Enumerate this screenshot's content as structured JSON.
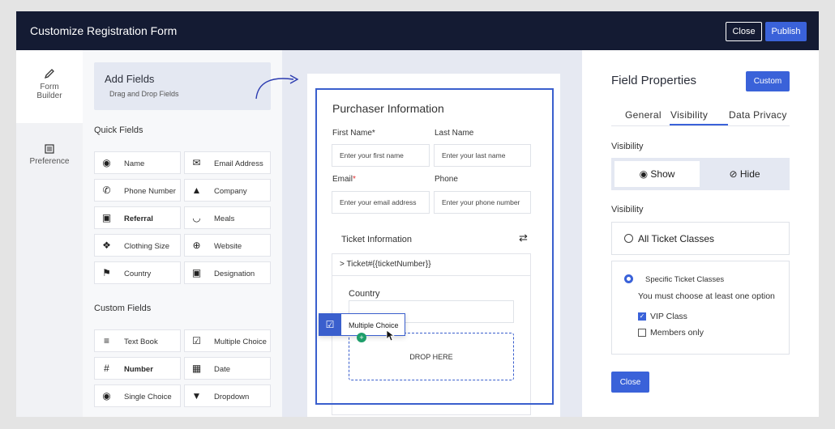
{
  "header": {
    "title": "Customize Registration Form",
    "close_label": "Close",
    "publish_label": "Publish"
  },
  "nav": {
    "form_builder_line1": "Form",
    "form_builder_line2": "Builder",
    "preference": "Preference"
  },
  "fields": {
    "add_title": "Add Fields",
    "add_subtitle": "Drag and Drop Fields",
    "quick_label": "Quick Fields",
    "quick": [
      "Name",
      "Email Address",
      "Phone Number",
      "Company",
      "Referral",
      "Meals",
      "Clothing Size",
      "Website",
      "Country",
      "Designation"
    ],
    "custom_label": "Custom Fields",
    "custom": [
      "Text Book",
      "Multiple Choice",
      "Number",
      "Date",
      "Single Choice",
      "Dropdown"
    ]
  },
  "form": {
    "purchaser_title": "Purchaser Information",
    "first_name_label": "First Name*",
    "last_name_label": "Last Name",
    "first_name_placeholder": "Enter your first name",
    "last_name_placeholder": "Enter your last name",
    "email_label": "Email",
    "email_req": "*",
    "phone_label": "Phone",
    "email_placeholder": "Enter your email address",
    "phone_placeholder": "Enter your phone number",
    "ticket_title": "Ticket Information",
    "ticket_row": "> Ticket#{{ticketNumber}}",
    "country_label": "Country",
    "drop_here": "DROP HERE",
    "dragging": "Multiple Choice",
    "plus": "+"
  },
  "props": {
    "title": "Field Properties",
    "custom_label": "Custom",
    "tabs": [
      "General",
      "Visibility",
      "Data Privacy"
    ],
    "visibility_label": "Visibility",
    "show_label": "Show",
    "hide_label": "Hide",
    "visibility_label2": "Visibility",
    "all_classes": "All Ticket Classes",
    "specific_classes": "Specific Ticket Classes",
    "must_choose": "You must choose at least one option",
    "vip": "VIP Class",
    "members": "Members only",
    "close_label": "Close"
  },
  "colors": {
    "header_bg": "#141b33",
    "accent": "#3a62d9",
    "canvas_bg": "#e6e9f2",
    "success": "#1e9e6a"
  }
}
